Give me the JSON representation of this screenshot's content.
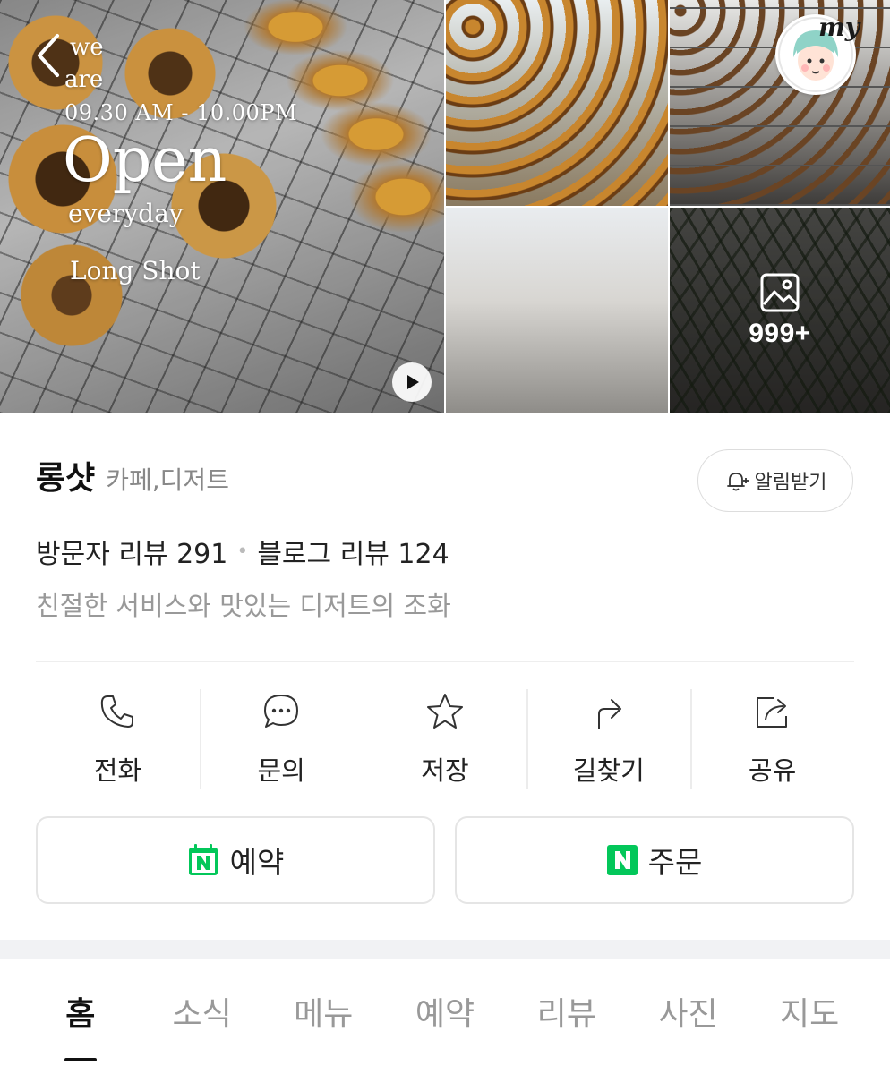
{
  "gallery": {
    "overlay": {
      "we": "we",
      "are": "are",
      "hours": "09.30 AM - 10.00PM",
      "open": "Open",
      "everyday": "everyday",
      "brand": "Long Shot"
    },
    "more_count": "999+",
    "my_badge": "my"
  },
  "place": {
    "name": "롱샷",
    "category": "카페,디저트",
    "notify_label": "알림받기",
    "visitor_reviews": "방문자 리뷰 291",
    "blog_reviews": "블로그 리뷰 124",
    "description": "친절한 서비스와 맛있는 디저트의 조화"
  },
  "actions": [
    {
      "label": "전화",
      "icon": "phone-icon"
    },
    {
      "label": "문의",
      "icon": "chat-icon"
    },
    {
      "label": "저장",
      "icon": "star-icon"
    },
    {
      "label": "길찾기",
      "icon": "directions-icon"
    },
    {
      "label": "공유",
      "icon": "share-icon"
    }
  ],
  "cta": {
    "book_label": "예약",
    "order_label": "주문",
    "naver_color": "#03c75a"
  },
  "tabs": [
    {
      "label": "홈",
      "active": true
    },
    {
      "label": "소식",
      "active": false
    },
    {
      "label": "메뉴",
      "active": false
    },
    {
      "label": "예약",
      "active": false
    },
    {
      "label": "리뷰",
      "active": false
    },
    {
      "label": "사진",
      "active": false
    },
    {
      "label": "지도",
      "active": false
    }
  ]
}
